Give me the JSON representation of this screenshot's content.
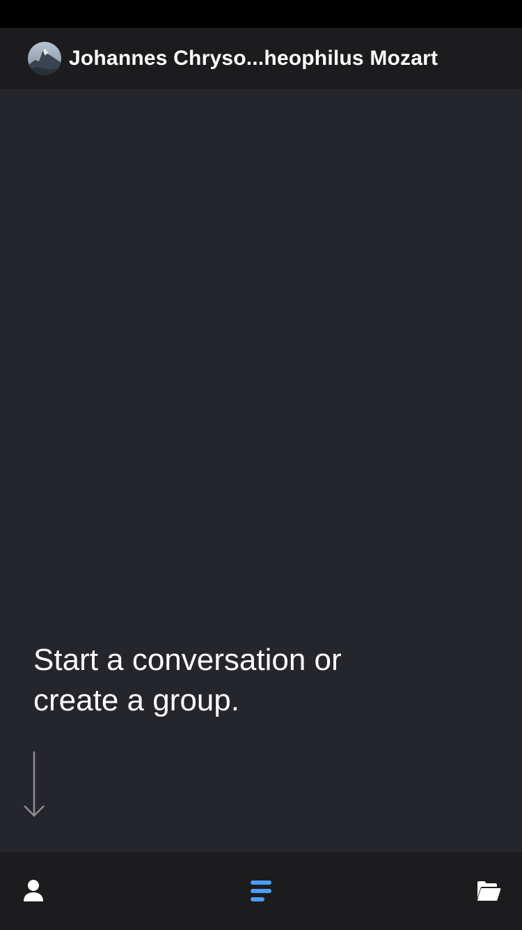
{
  "header": {
    "avatar_alt": "Mountain avatar",
    "title": "Johannes Chryso...heophilus Mozart"
  },
  "main": {
    "empty_message": "Start a conversation or create a group."
  },
  "tab_bar": {
    "tabs": [
      {
        "icon": "person-icon",
        "active": false
      },
      {
        "icon": "chat-list-icon",
        "active": true
      },
      {
        "icon": "folder-open-icon",
        "active": false
      }
    ]
  },
  "colors": {
    "background": "#25262b",
    "bar_background": "#1c1c1e",
    "accent": "#4a9eff",
    "text": "#ffffff",
    "arrow": "#8e8e93"
  }
}
